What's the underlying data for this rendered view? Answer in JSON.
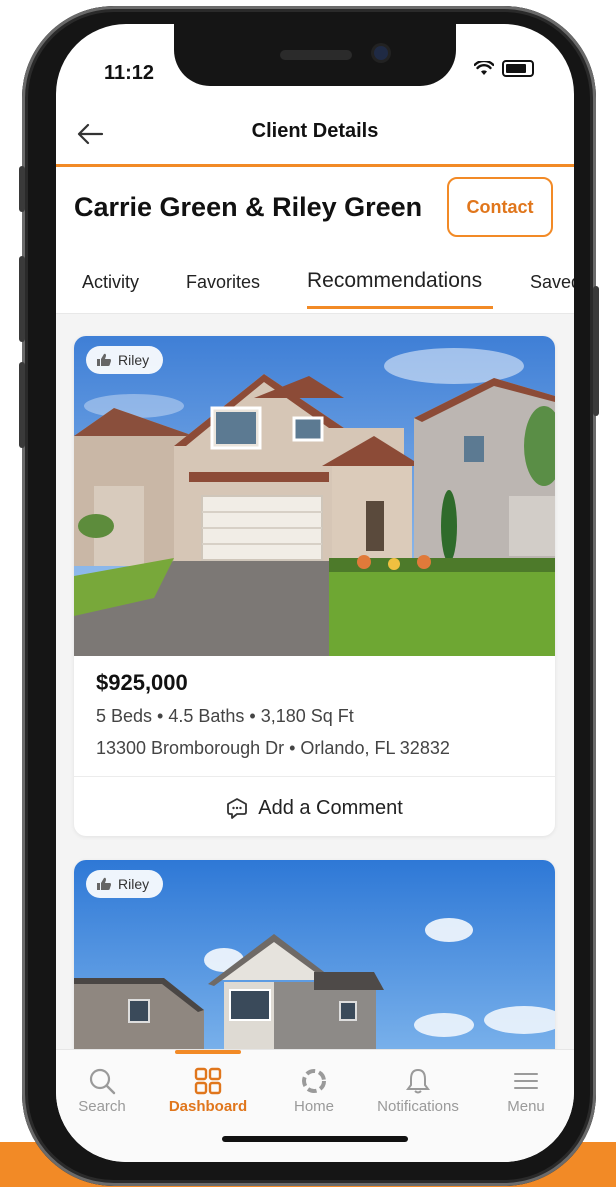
{
  "status_bar": {
    "time": "11:12"
  },
  "header": {
    "title": "Client Details"
  },
  "client": {
    "name": "Carrie Green & Riley Green",
    "contact_label": "Contact"
  },
  "tabs": [
    {
      "label": "Activity"
    },
    {
      "label": "Favorites"
    },
    {
      "label": "Recommendations",
      "active": true
    },
    {
      "label": "Saved"
    }
  ],
  "listings": [
    {
      "liked_by": "Riley",
      "price": "$925,000",
      "specs": "5 Beds • 4.5 Baths • 3,180 Sq Ft",
      "address": "13300 Bromborough Dr • Orlando, FL 32832",
      "comment_label": "Add a Comment"
    },
    {
      "liked_by": "Riley"
    }
  ],
  "bottom_nav": [
    {
      "label": "Search",
      "icon": "search-icon"
    },
    {
      "label": "Dashboard",
      "icon": "grid-icon",
      "active": true
    },
    {
      "label": "Home",
      "icon": "home-logo-icon"
    },
    {
      "label": "Notifications",
      "icon": "bell-icon"
    },
    {
      "label": "Menu",
      "icon": "hamburger-icon"
    }
  ],
  "colors": {
    "accent": "#f28a26",
    "accent_text": "#e0761c"
  }
}
